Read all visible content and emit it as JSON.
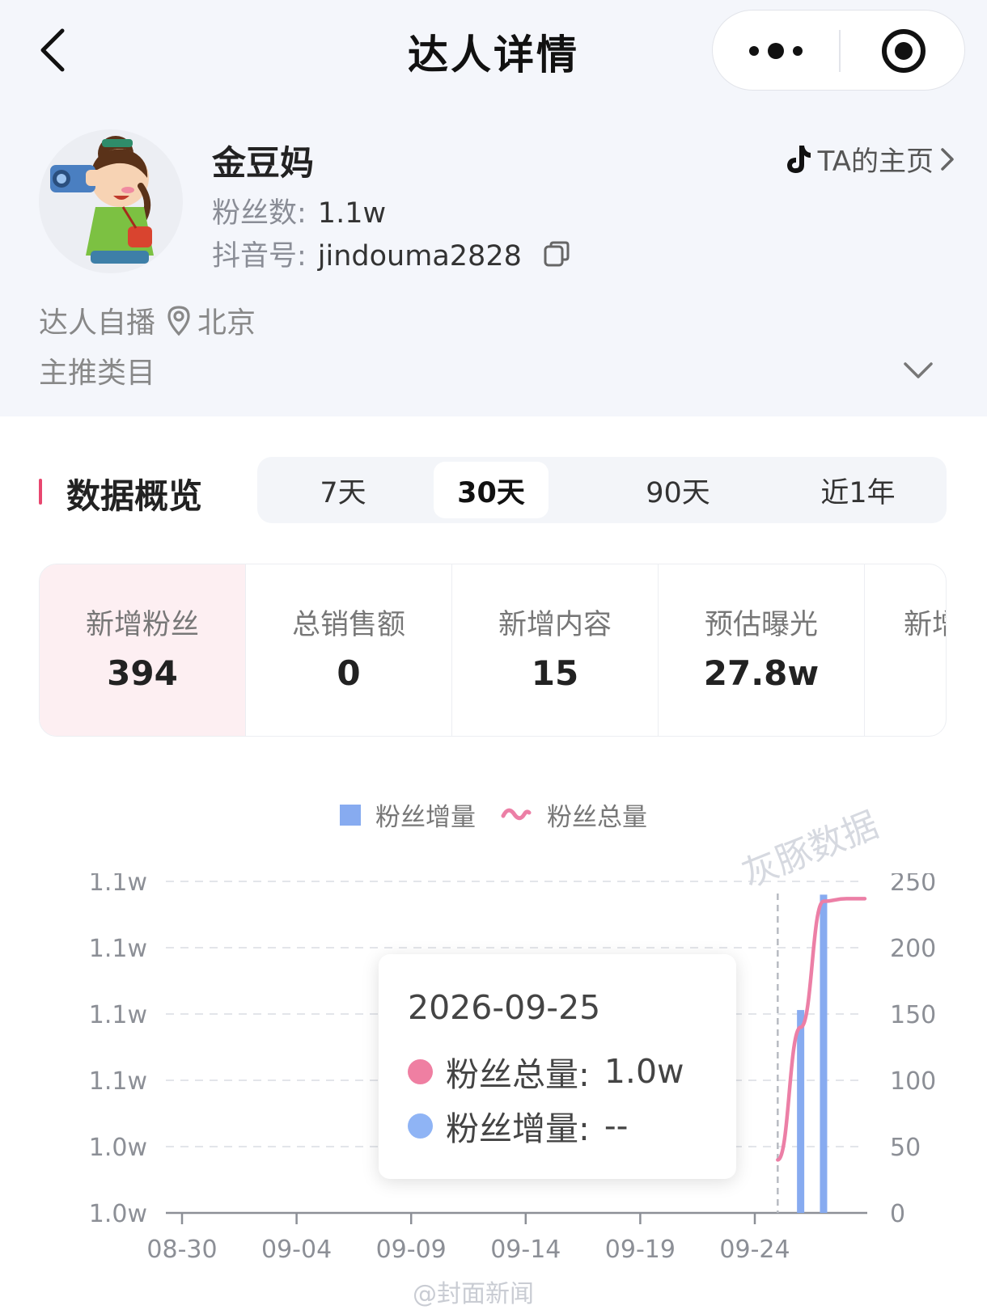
{
  "nav": {
    "title": "达人详情"
  },
  "profile": {
    "name": "金豆妈",
    "fans_label": "粉丝数:",
    "fans_value": "1.1w",
    "douyin_label": "抖音号:",
    "douyin_id": "jindouma2828",
    "homepage_link": "TA的主页",
    "type_tag": "达人自播",
    "location": "北京",
    "category_label": "主推类目"
  },
  "overview": {
    "title": "数据概览",
    "tabs": [
      {
        "label": "7天",
        "active": false
      },
      {
        "label": "30天",
        "active": true
      },
      {
        "label": "90天",
        "active": false
      },
      {
        "label": "近1年",
        "active": false
      }
    ],
    "stats": [
      {
        "label": "新增粉丝",
        "value": "394",
        "active": true
      },
      {
        "label": "总销售额",
        "value": "0",
        "active": false
      },
      {
        "label": "新增内容",
        "value": "15",
        "active": false
      },
      {
        "label": "预估曝光",
        "value": "27.8w",
        "active": false
      },
      {
        "label": "新增",
        "value": "",
        "active": false
      }
    ]
  },
  "chart_data": {
    "type": "bar",
    "legend": [
      {
        "name": "粉丝增量",
        "kind": "bar",
        "color": "#87abf0"
      },
      {
        "name": "粉丝总量",
        "kind": "line",
        "color": "#ec7fa6"
      }
    ],
    "x_tick_labels": [
      "08-30",
      "09-04",
      "09-09",
      "09-14",
      "09-19",
      "09-24"
    ],
    "y_left_tick_labels": [
      "1.0w",
      "1.0w",
      "1.1w",
      "1.1w",
      "1.1w",
      "1.1w"
    ],
    "y_right_tick_labels": [
      "0",
      "50",
      "100",
      "150",
      "200",
      "250"
    ],
    "y_right_range": [
      0,
      250
    ],
    "x_range": [
      0,
      29
    ],
    "grid": "dashed-horizontal",
    "series": [
      {
        "name": "粉丝增量",
        "type": "bar",
        "points": [
          {
            "day": 27,
            "value": 153
          },
          {
            "day": 28,
            "value": 240
          }
        ]
      },
      {
        "name": "粉丝总量",
        "type": "line",
        "points": [
          {
            "day": 26,
            "value": 40
          },
          {
            "day": 27,
            "value": 140
          },
          {
            "day": 28,
            "value": 235
          },
          {
            "day": 29,
            "value": 237
          },
          {
            "day": 29.8,
            "value": 237
          }
        ]
      }
    ],
    "cursor_day": 26,
    "tooltip": {
      "date": "2026-09-25",
      "rows": [
        {
          "label": "粉丝总量:",
          "value": "1.0w",
          "color": "#ef7fa2"
        },
        {
          "label": "粉丝增量:",
          "value": "--",
          "color": "#8fb4f5"
        }
      ]
    }
  },
  "watermarks": {
    "logo_text": "灰豚数据",
    "bottom_text": "@封面新闻"
  },
  "icons": [
    "back-arrow-icon",
    "more-dots-icon",
    "target-close-icon",
    "douyin-icon",
    "chevron-right-icon",
    "copy-icon",
    "location-pin-icon",
    "chevron-down-icon"
  ]
}
